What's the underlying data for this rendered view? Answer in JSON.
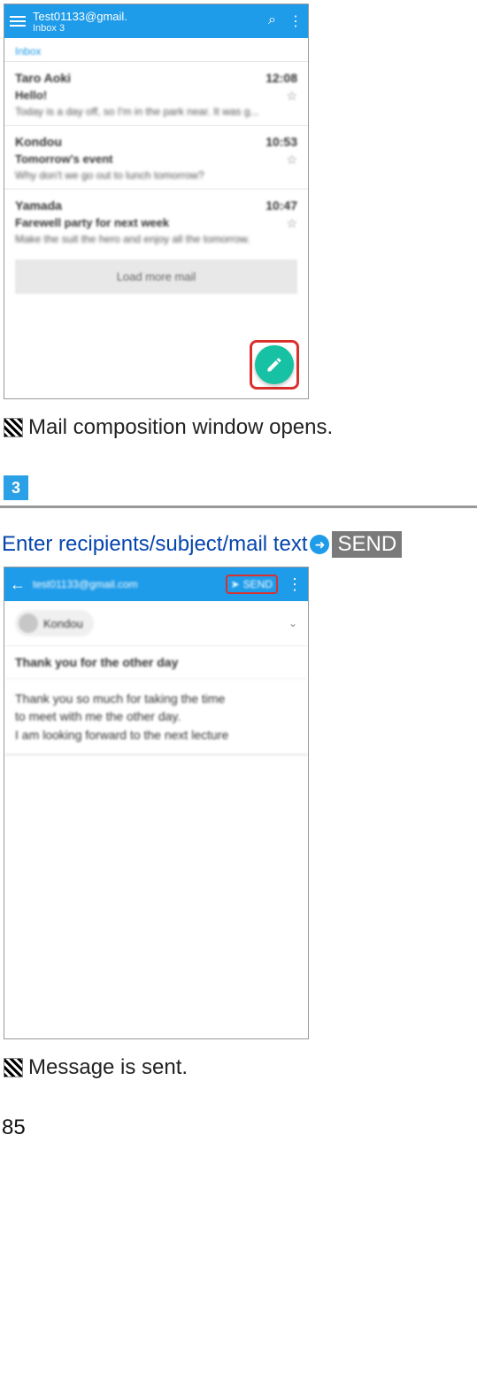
{
  "screenshot1": {
    "title_line1": "Test01133@gmail.",
    "title_line2": "Inbox 3",
    "inbox_label": "Inbox",
    "messages": [
      {
        "sender": "Taro Aoki",
        "time": "12:08",
        "subject": "Hello!",
        "preview": "Today is a day off, so I'm in the park near. It was g..."
      },
      {
        "sender": "Kondou",
        "time": "10:53",
        "subject": "Tomorrow's event",
        "preview": "Why don't we go out to lunch tomorrow?"
      },
      {
        "sender": "Yamada",
        "time": "10:47",
        "subject": "Farewell party for next week",
        "preview": "Make the suit the hero and enjoy all the tomorrow."
      }
    ],
    "load_more": "Load more mail"
  },
  "result1": "Mail composition window opens.",
  "step_number": "3",
  "instruction_text": "Enter recipients/subject/mail text",
  "send_label": "SEND",
  "screenshot2": {
    "from": "test01133@gmail.com",
    "send_btn": "SEND",
    "to_chip": "Kondou",
    "subject": "Thank you for the other day",
    "body_line1": "Thank you so much for taking the time",
    "body_line2": "to meet with me the other day.",
    "body_line3": "I am looking forward to the next lecture"
  },
  "result2": "Message is sent.",
  "page_number": "85"
}
